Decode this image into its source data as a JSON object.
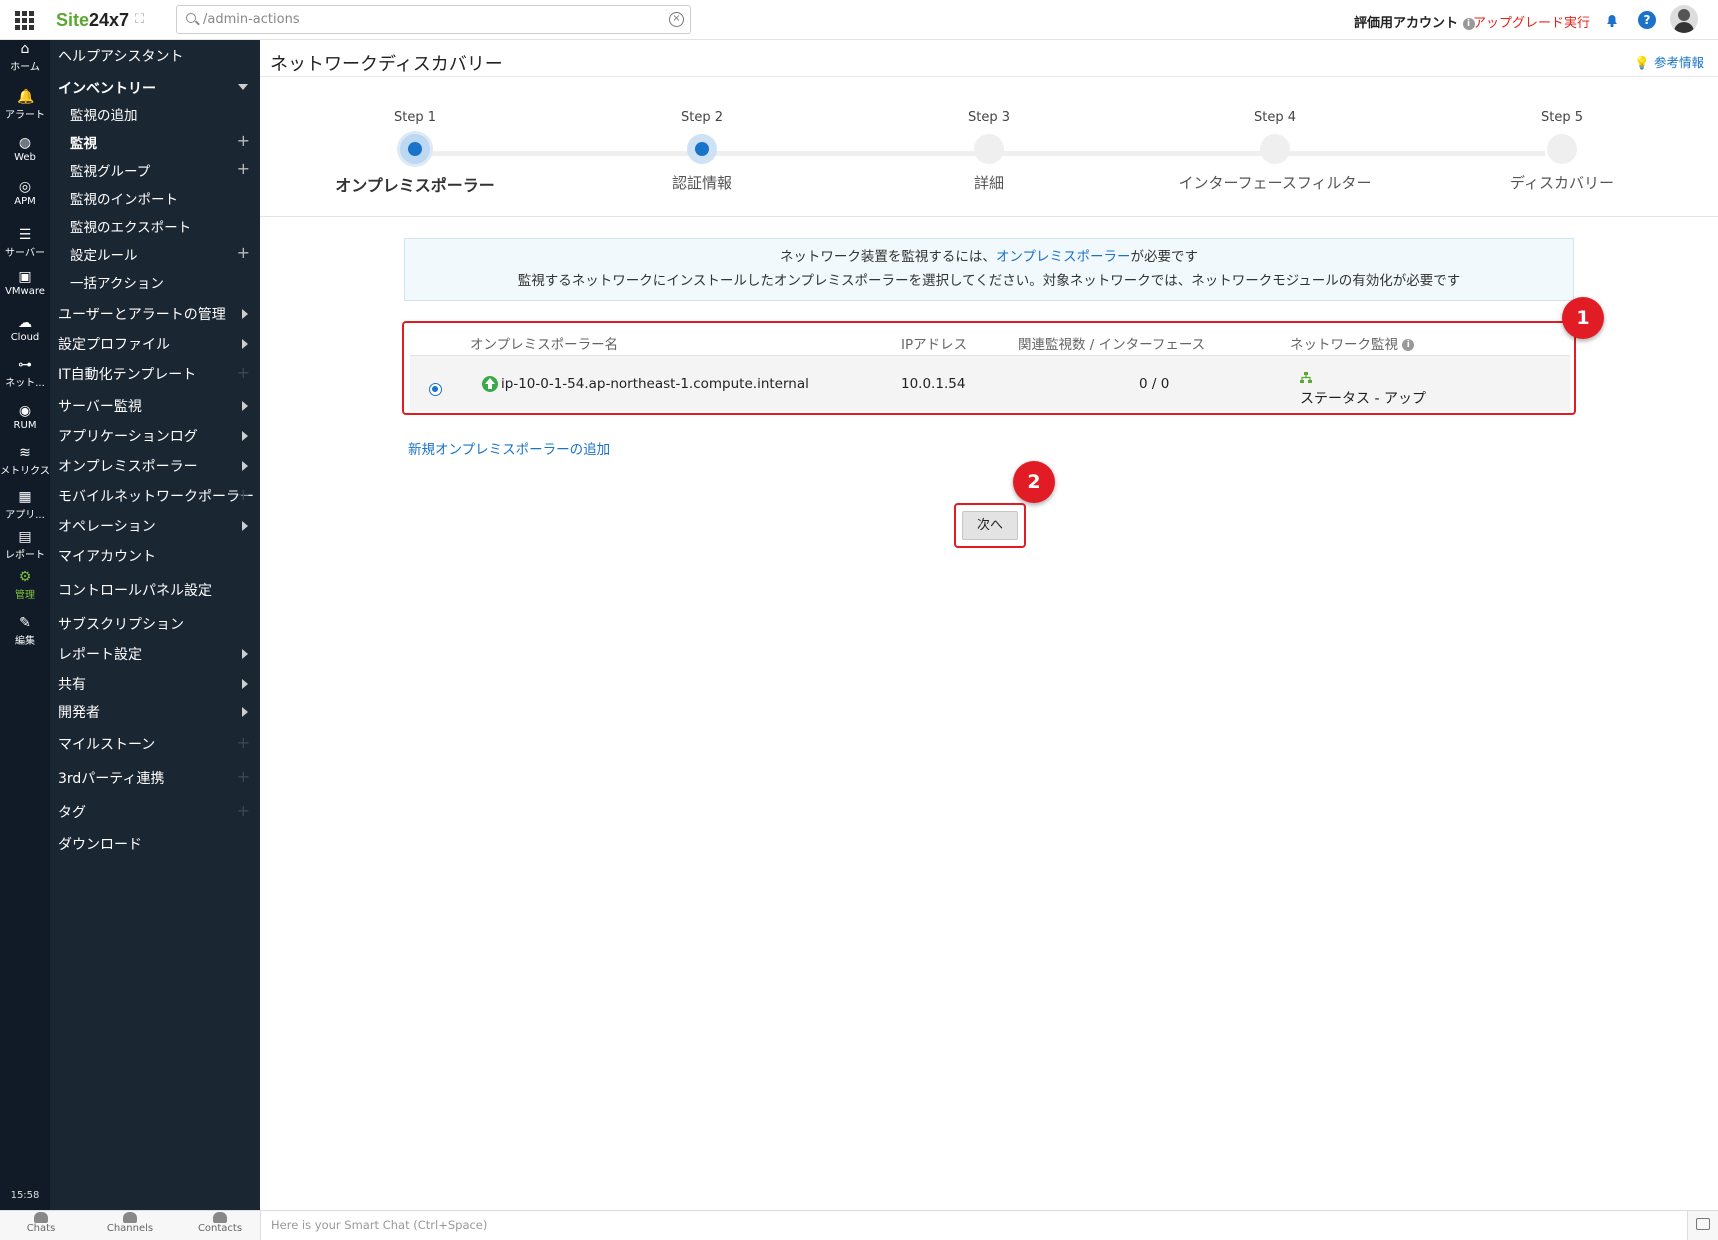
{
  "topbar": {
    "logo_site": "Site",
    "logo_num": "24x7",
    "search_value": "/admin-actions",
    "account_label": "評価用アカウント",
    "upgrade_label": "アップグレード実行"
  },
  "rail": [
    {
      "label": "ホーム",
      "icon": "home-icon"
    },
    {
      "label": "アラート",
      "icon": "bell-icon"
    },
    {
      "label": "Web",
      "icon": "globe-icon"
    },
    {
      "label": "APM",
      "icon": "binoculars-icon"
    },
    {
      "label": "サーバー",
      "icon": "server-icon"
    },
    {
      "label": "VMware",
      "icon": "vm-icon"
    },
    {
      "label": "Cloud",
      "icon": "cloud-icon"
    },
    {
      "label": "ネット...",
      "icon": "network-icon"
    },
    {
      "label": "RUM",
      "icon": "rum-icon"
    },
    {
      "label": "メトリクス",
      "icon": "layers-icon"
    },
    {
      "label": "アプリ...",
      "icon": "app-icon"
    },
    {
      "label": "レポート",
      "icon": "report-icon"
    },
    {
      "label": "管理",
      "icon": "gear-icon"
    },
    {
      "label": "編集",
      "icon": "edit-icon"
    }
  ],
  "rail_time": "15:58",
  "sidebar": {
    "items": [
      "ヘルプアシスタント",
      "インベントリー",
      "ユーザーとアラートの管理",
      "設定プロファイル",
      "IT自動化テンプレート",
      "サーバー監視",
      "アプリケーションログ",
      "オンプレミスポーラー",
      "モバイルネットワークポーラー",
      "オペレーション",
      "マイアカウント",
      "コントロールパネル設定",
      "サブスクリプション",
      "レポート設定",
      "共有",
      "開発者",
      "マイルストーン",
      "3rdパーティ連携",
      "タグ",
      "ダウンロード"
    ],
    "sub_items": [
      "監視の追加",
      "監視",
      "監視グループ",
      "監視のインポート",
      "監視のエクスポート",
      "設定ルール",
      "一括アクション"
    ]
  },
  "page": {
    "title": "ネットワークディスカバリー",
    "ref_link": "参考情報"
  },
  "steps": [
    {
      "label": "Step 1",
      "name": "オンプレミスポーラー"
    },
    {
      "label": "Step 2",
      "name": "認証情報"
    },
    {
      "label": "Step 3",
      "name": "詳細"
    },
    {
      "label": "Step 4",
      "name": "インターフェースフィルター"
    },
    {
      "label": "Step 5",
      "name": "ディスカバリー"
    }
  ],
  "notice": {
    "line1_pre": "ネットワーク装置を監視するには、",
    "line1_link": "オンプレミスポーラー",
    "line1_post": "が必要です",
    "line2": "監視するネットワークにインストールしたオンプレミスポーラーを選択してください。対象ネットワークでは、ネットワークモジュールの有効化が必要です"
  },
  "table": {
    "headers": [
      "オンプレミスポーラー名",
      "IPアドレス",
      "関連監視数 / インターフェース",
      "ネットワーク監視"
    ],
    "row": {
      "name": "ip-10-0-1-54.ap-northeast-1.compute.internal",
      "ip": "10.0.1.54",
      "count": "0 / 0",
      "status": "ステータス - アップ"
    }
  },
  "add_link": "新規オンプレミスポーラーの追加",
  "next_button": "次へ",
  "badges": [
    "1",
    "2"
  ],
  "bottom": {
    "chats": "Chats",
    "channels": "Channels",
    "contacts": "Contacts",
    "chat_placeholder": "Here is your Smart Chat (Ctrl+Space)"
  },
  "colors": {
    "accent": "#1a73c9",
    "highlight": "#e21c24",
    "sidebar": "#1b2633",
    "rail": "#111b27",
    "status_up": "#3aaa49"
  }
}
